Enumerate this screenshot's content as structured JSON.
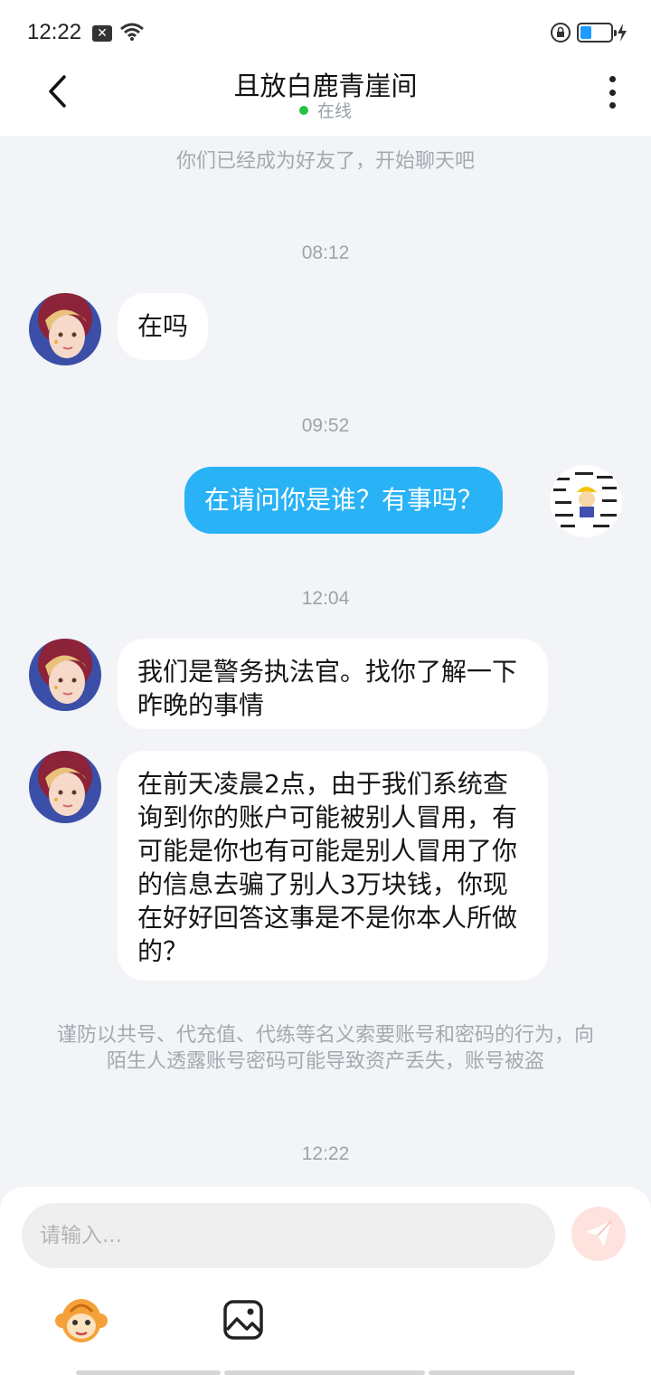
{
  "status": {
    "time": "12:22",
    "notification_icon": "close-box-icon",
    "wifi_icon": "wifi-icon",
    "lock_icon": "rotation-lock-icon",
    "battery_level": 0.25,
    "charging_icon": "charging-bolt-icon"
  },
  "header": {
    "title": "且放白鹿青崖间",
    "status": "在线",
    "status_color": "#26c244",
    "back_icon": "chevron-left-icon",
    "more_icon": "more-vertical-icon"
  },
  "chat": {
    "friend_notice": "你们已经成为好友了，开始聊天吧",
    "timestamps": [
      "08:12",
      "09:52",
      "12:04",
      "12:22"
    ],
    "messages": [
      {
        "sender": "other",
        "text": "在吗"
      },
      {
        "sender": "me",
        "text": "在请问你是谁？有事吗？"
      },
      {
        "sender": "other",
        "text": "我们是警务执法官。找你了解一下昨晚的事情"
      },
      {
        "sender": "other",
        "text": "在前天凌晨2点，由于我们系统查询到你的账户可能被别人冒用，有可能是你也有可能是别人冒用了你的信息去骗了别人3万块钱，你现在好好回答这事是不是你本人所做的？"
      }
    ],
    "warning": "谨防以共号、代充值、代练等名义索要账号和密码的行为，向陌生人透露账号密码可能导致资产丢失，账号被盗"
  },
  "composer": {
    "placeholder": "请输入...",
    "send_icon": "paper-plane-icon",
    "emoji_icon": "monkey-sticker-icon",
    "image_icon": "image-icon"
  },
  "colors": {
    "accent": "#29b2f6",
    "send_button": "#fde2de",
    "background": "#f2f4f7"
  }
}
